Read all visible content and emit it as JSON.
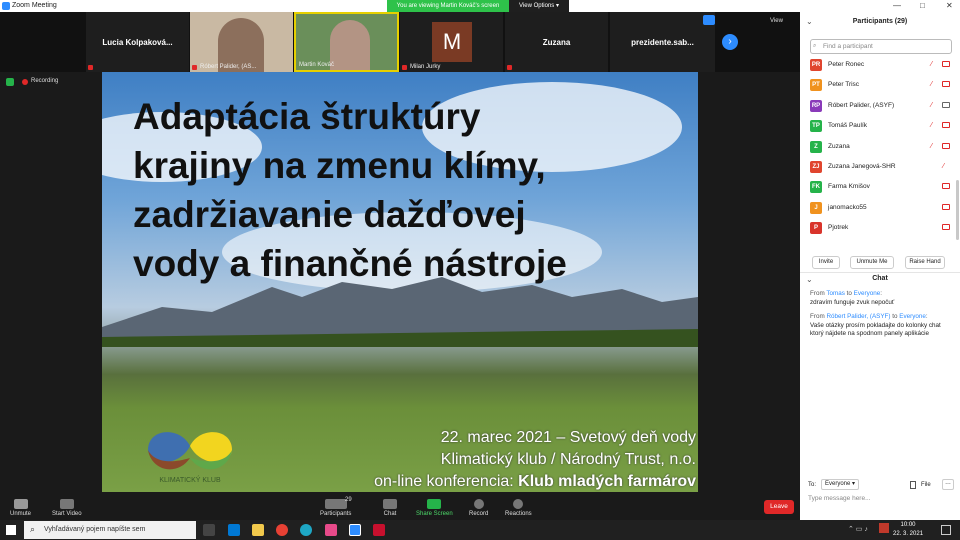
{
  "window": {
    "title": "Zoom Meeting",
    "controls": [
      "—",
      "□",
      "✕"
    ]
  },
  "banner": {
    "viewing": "You are viewing Martin Kováč's screen",
    "view_options": "View Options ▾"
  },
  "view_button": "View",
  "recording": "Recording",
  "gallery": {
    "tiles": [
      {
        "name": "Lucia  Kolpaková...",
        "label": ""
      },
      {
        "name": "",
        "label": "Róbert Palider, (AS..."
      },
      {
        "name": "",
        "label": "Martin Kováč"
      },
      {
        "name": "M",
        "label": "Milan Jurky"
      },
      {
        "name": "Zuzana",
        "label": ""
      },
      {
        "name": "prezidente.sab...",
        "label": ""
      }
    ]
  },
  "slide": {
    "title_lines": [
      "Adaptácia štruktúry",
      "krajiny na zmenu klímy,",
      "zadržiavanie dažďovej",
      "vody a finančné nástroje"
    ],
    "footer_lines": [
      "22. marec 2021 – Svetový deň vody",
      "Klimatický klub / Národný Trust, n.o.",
      "on-line  konferencia: "
    ],
    "footer_bold": "Klub mladých farmárov",
    "logo_text": "KLIMATICKÝ KLUB"
  },
  "participants": {
    "header": "Participants (29)",
    "search_placeholder": "Find a participant",
    "list": [
      {
        "initials": "PR",
        "name": "Peter Ronec",
        "color": "#e0452e"
      },
      {
        "initials": "PT",
        "name": "Peter Trisc",
        "color": "#f0921e"
      },
      {
        "initials": "RP",
        "name": "Róbert Palider, (ASYF)",
        "color": "#8a3ab9"
      },
      {
        "initials": "TP",
        "name": "Tomáš Paulík",
        "color": "#25b34a"
      },
      {
        "initials": "Z",
        "name": "Zuzana",
        "color": "#25b34a"
      },
      {
        "initials": "ZJ",
        "name": "Zuzana Janegová-SHR",
        "color": "#e0452e"
      },
      {
        "initials": "FK",
        "name": "Farma Kmišov",
        "color": "#25b34a"
      },
      {
        "initials": "J",
        "name": "janomacko55",
        "color": "#f0921e"
      },
      {
        "initials": "P",
        "name": "Pjotrek",
        "color": "#d9342b"
      }
    ],
    "buttons": [
      "Invite",
      "Unmute Me",
      "Raise Hand"
    ]
  },
  "chat": {
    "header": "Chat",
    "messages": [
      {
        "from": "Tomas",
        "to": "Everyone",
        "text": "zdravím funguje zvuk nepočuť"
      },
      {
        "from": "Róbert Palider, (ASYF)",
        "to": "Everyone",
        "text": "Vaše otázky prosím pokladajte do kolonky chat ktorý nájdete na spodnom panely aplikácie"
      }
    ],
    "to_label": "To:",
    "to_value": "Everyone ▾",
    "file_label": "File",
    "placeholder": "Type message here..."
  },
  "toolbar": {
    "items": [
      "Unmute",
      "Start Video",
      "Participants",
      "Chat",
      "Share Screen",
      "Record",
      "Reactions"
    ],
    "participants_count": "29",
    "leave": "Leave"
  },
  "taskbar": {
    "search": "Vyhľadávaný pojem napíšte sem",
    "time": "10:00",
    "date": "22. 3. 2021"
  }
}
